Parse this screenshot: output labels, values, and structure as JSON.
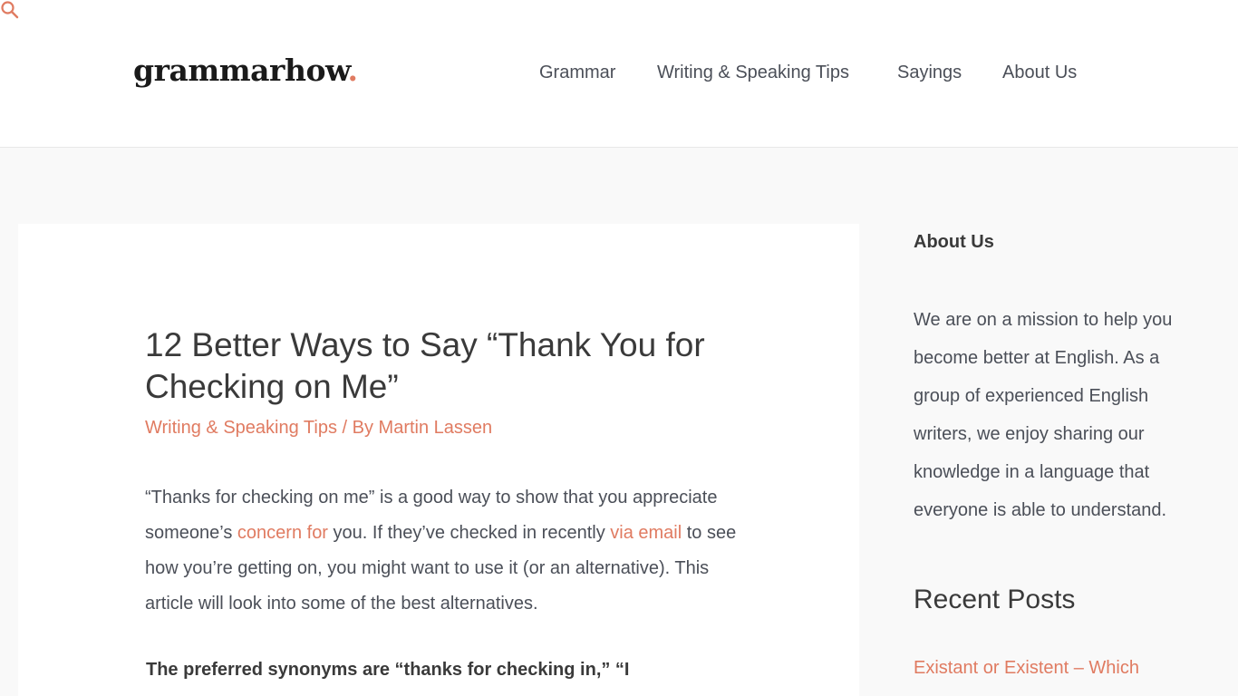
{
  "header": {
    "logo_text": "grammarhow",
    "logo_dot": ".",
    "nav": [
      {
        "label": "Grammar"
      },
      {
        "label": "Writing & Speaking Tips"
      },
      {
        "label": "Sayings"
      },
      {
        "label": "About Us"
      }
    ],
    "search_icon": "search-icon"
  },
  "colors": {
    "accent": "#e07b61",
    "text": "#3a3a3a",
    "body_text": "#4b4f58",
    "page_bg": "#f9f9f9"
  },
  "article": {
    "title": "12 Better Ways to Say “Thank You for Checking on Me”",
    "category": "Writing & Speaking Tips",
    "byline_sep": " / By ",
    "author": "Martin Lassen",
    "intro": {
      "part1": "“Thanks for checking on me” is a good way to show that you appreciate someone’s ",
      "link1": "concern for",
      "part2": " you. If they’ve checked in recently ",
      "link2": "via email",
      "part3": " to see how you’re getting on, you might want to use it (or an alternative). This article will look into some of the best alternatives."
    },
    "bold_para": "The preferred synonyms are “thanks for checking in,” “I"
  },
  "sidebar": {
    "about_title": "About Us",
    "about_text": "We are on a mission to help you become better at English. As a group of experienced English writers, we enjoy sharing our knowledge in a language that everyone is able to understand.",
    "recent_title": "Recent Posts",
    "recent_posts": [
      {
        "label": "Existant or Existent – Which"
      }
    ]
  }
}
